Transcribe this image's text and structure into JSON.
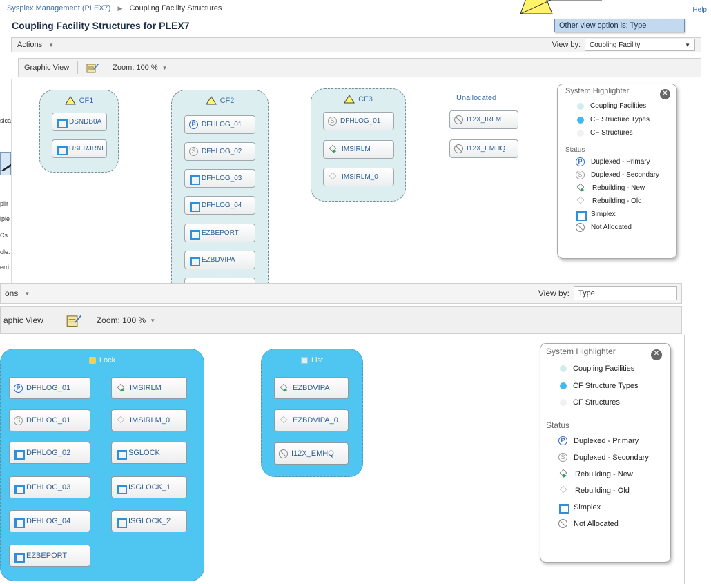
{
  "header": {
    "breadcrumb_root": "Sysplex Management (PLEX7)",
    "breadcrumb_current": "Coupling Facility Structures",
    "help": "Help",
    "title": "Coupling Facility Structures for PLEX7",
    "tooltip": "Other view option is: Type"
  },
  "top": {
    "actions": "Actions",
    "view_by_label": "View by:",
    "view_by_value": "Coupling Facility",
    "graphic_view": "Graphic View",
    "zoom": "Zoom: 100 %",
    "groups": [
      {
        "title": "CF1",
        "nodes": [
          {
            "icon": "simplex",
            "label": "DSNDB0A"
          },
          {
            "icon": "simplex",
            "label": "USERJRNL"
          }
        ]
      },
      {
        "title": "CF2",
        "nodes": [
          {
            "icon": "primary",
            "label": "DFHLOG_01"
          },
          {
            "icon": "secondary",
            "label": "DFHLOG_02"
          },
          {
            "icon": "simplex",
            "label": "DFHLOG_03"
          },
          {
            "icon": "simplex",
            "label": "DFHLOG_04"
          },
          {
            "icon": "simplex",
            "label": "EZBEPORT"
          },
          {
            "icon": "simplex",
            "label": "EZBDVIPA"
          }
        ]
      },
      {
        "title": "CF3",
        "nodes": [
          {
            "icon": "secondary",
            "label": "DFHLOG_01"
          },
          {
            "icon": "rebuild-new",
            "label": "IMSIRLM"
          },
          {
            "icon": "rebuild-old",
            "label": "IMSIRLM_0"
          }
        ]
      },
      {
        "title": "Unallocated",
        "nodes": [
          {
            "icon": "not-allocated",
            "label": "I12X_IRLM"
          },
          {
            "icon": "not-allocated",
            "label": "I12X_EMHQ"
          }
        ]
      }
    ],
    "left_fragment": [
      "sica",
      "plir",
      "iple",
      "Cs",
      "ole:",
      "erri"
    ]
  },
  "bottom": {
    "actions": "ons",
    "view_by_label": "View by:",
    "view_by_value": "Type",
    "graphic_view": "aphic View",
    "zoom": "Zoom: 100 %",
    "lock": {
      "title": "Lock",
      "nodes": [
        {
          "icon": "primary",
          "label": "DFHLOG_01"
        },
        {
          "icon": "rebuild-new",
          "label": "IMSIRLM"
        },
        {
          "icon": "secondary",
          "label": "DFHLOG_01"
        },
        {
          "icon": "rebuild-old",
          "label": "IMSIRLM_0"
        },
        {
          "icon": "simplex",
          "label": "DFHLOG_02"
        },
        {
          "icon": "simplex",
          "label": "SGLOCK"
        },
        {
          "icon": "simplex",
          "label": "DFHLOG_03"
        },
        {
          "icon": "simplex",
          "label": "ISGLOCK_1"
        },
        {
          "icon": "simplex",
          "label": "DFHLOG_04"
        },
        {
          "icon": "simplex",
          "label": "ISGLOCK_2"
        },
        {
          "icon": "simplex",
          "label": "EZBEPORT"
        }
      ]
    },
    "list": {
      "title": "List",
      "nodes": [
        {
          "icon": "rebuild-new",
          "label": "EZBDVIPA"
        },
        {
          "icon": "rebuild-old",
          "label": "EZBDVIPA_0"
        },
        {
          "icon": "not-allocated",
          "label": "I12X_EMHQ"
        }
      ]
    }
  },
  "legend": {
    "title": "System Highlighter",
    "items": [
      "Coupling Facilities",
      "CF Structure Types",
      "CF Structures"
    ],
    "status_title": "Status",
    "status": [
      {
        "icon": "primary",
        "label": "Duplexed - Primary"
      },
      {
        "icon": "secondary",
        "label": "Duplexed - Secondary"
      },
      {
        "icon": "rebuild-new",
        "label": "Rebuilding - New"
      },
      {
        "icon": "rebuild-old",
        "label": "Rebuilding - Old"
      },
      {
        "icon": "simplex",
        "label": "Simplex"
      },
      {
        "icon": "not-allocated",
        "label": "Not Allocated"
      }
    ],
    "colors": {
      "cf": "#d3ecef",
      "types": "#3fb9ee",
      "structures": "#f1f1f1"
    }
  }
}
